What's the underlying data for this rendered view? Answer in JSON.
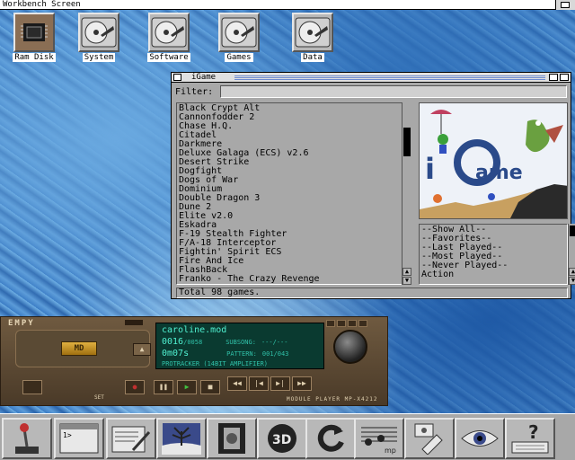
{
  "screen": {
    "title": "Workbench Screen"
  },
  "desktop_icons": [
    {
      "label": "Ram Disk",
      "icon": "ram-disk-icon"
    },
    {
      "label": "System",
      "icon": "hard-disk-icon"
    },
    {
      "label": "Software",
      "icon": "hard-disk-icon"
    },
    {
      "label": "Games",
      "icon": "hard-disk-icon"
    },
    {
      "label": "Data",
      "icon": "hard-disk-icon"
    }
  ],
  "igame": {
    "title": "iGame",
    "filter_label": "Filter:",
    "filter_value": "",
    "games": [
      "Black Crypt Alt",
      "Cannonfodder 2",
      "Chase H.Q.",
      "Citadel",
      "Darkmere",
      "Deluxe Galaga (ECS) v2.6",
      "Desert Strike",
      "Dogfight",
      "Dogs of War",
      "Dominium",
      "Double Dragon 3",
      "Dune 2",
      "Elite v2.0",
      "Eskadra",
      "F-19 Stealth Fighter",
      "F/A-18 Interceptor",
      "Fightin' Spirit ECS",
      "Fire And Ice",
      "FlashBack",
      "Franko - The Crazy Revenge"
    ],
    "filters": [
      "--Show All--",
      "--Favorites--",
      "--Last Played--",
      "--Most Played--",
      "--Never Played--",
      "Action"
    ],
    "status": "Total 98 games.",
    "preview_logo": "iGame"
  },
  "player": {
    "brand": "EMPY",
    "md_label": "MD",
    "filename": "caroline.mod",
    "track": "0016",
    "track_total": "0058",
    "subsong_label": "SUBSONG:",
    "subsong_value": "---/---",
    "time": "0m07s",
    "pattern_label": "PATTERN:",
    "pattern_value": "001/043",
    "format": "PROTRACKER (14BIT AMPLIFIER)",
    "model": "MODULE PLAYER MP-X4212",
    "set_label": "SET"
  },
  "dock": [
    {
      "icon": "joystick-icon"
    },
    {
      "icon": "shell-icon"
    },
    {
      "icon": "editor-icon"
    },
    {
      "icon": "picture-icon"
    },
    {
      "icon": "film-icon"
    },
    {
      "icon": "3d-icon"
    },
    {
      "icon": "reload-icon"
    },
    {
      "icon": "music-icon"
    },
    {
      "icon": "tools-icon"
    },
    {
      "icon": "eye-icon"
    },
    {
      "icon": "help-icon"
    }
  ],
  "colors": {
    "background": "#3b7cc5",
    "window": "#a8a8a8",
    "lcd": "#0a3a30",
    "lcd_text": "#30e0c0"
  }
}
